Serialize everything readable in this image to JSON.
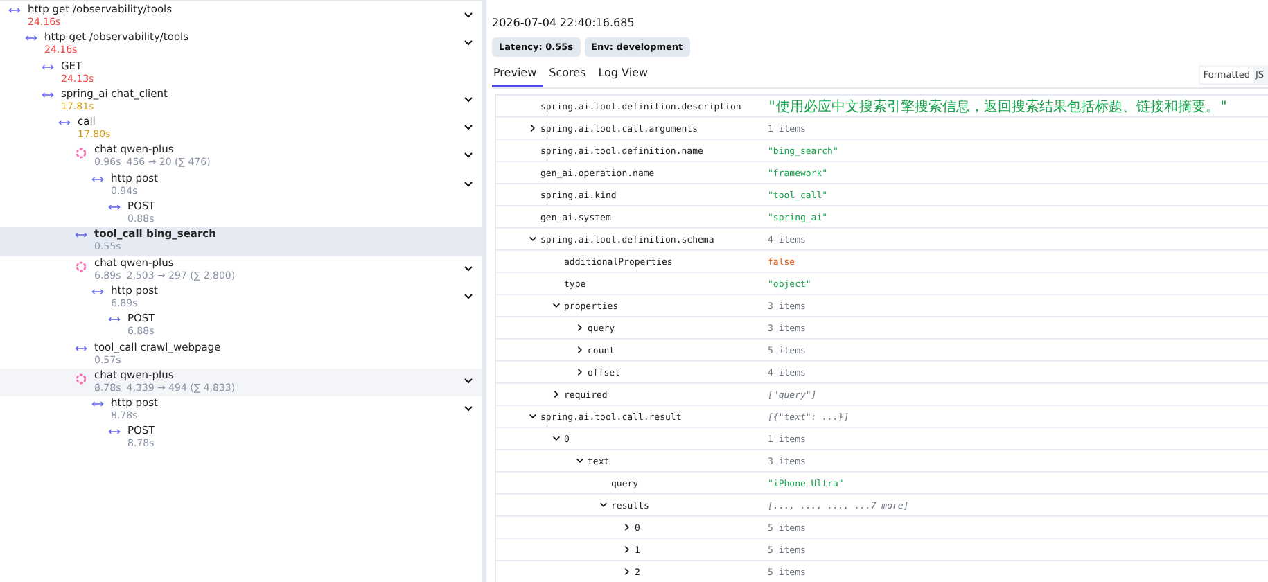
{
  "trace_tree": [
    {
      "name": "http get /observability/tools",
      "kind": "span",
      "duration": "24.16s",
      "color": "#ef4444",
      "expanded": true,
      "selected": false,
      "hovered": false,
      "children": [
        {
          "name": "http get /observability/tools",
          "kind": "span",
          "duration": "24.16s",
          "color": "#ef4444",
          "expanded": true,
          "selected": false,
          "hovered": false,
          "children": [
            {
              "name": "GET",
              "kind": "span",
              "duration": "24.13s",
              "color": "#ef4444",
              "selected": false,
              "hovered": false
            },
            {
              "name": "spring_ai chat_client",
              "kind": "span",
              "duration": "17.81s",
              "color": "#d4a017",
              "expanded": true,
              "selected": false,
              "hovered": false,
              "children": [
                {
                  "name": "call",
                  "kind": "span",
                  "duration": "17.80s",
                  "color": "#d4a017",
                  "expanded": true,
                  "selected": false,
                  "hovered": false,
                  "children": [
                    {
                      "name": "chat qwen-plus",
                      "kind": "generation",
                      "duration": "0.96s",
                      "tokens": "456 → 20 (∑ 476)",
                      "color": "#8a94a6",
                      "expanded": true,
                      "selected": false,
                      "hovered": false,
                      "children": [
                        {
                          "name": "http post",
                          "kind": "span",
                          "duration": "0.94s",
                          "color": "#8a94a6",
                          "expanded": true,
                          "selected": false,
                          "hovered": false,
                          "children": [
                            {
                              "name": "POST",
                              "kind": "span",
                              "duration": "0.88s",
                              "color": "#8a94a6",
                              "selected": false,
                              "hovered": false
                            }
                          ]
                        }
                      ]
                    },
                    {
                      "name": "tool_call bing_search",
                      "kind": "span",
                      "duration": "0.55s",
                      "color": "#8a94a6",
                      "selected": true,
                      "hovered": false
                    },
                    {
                      "name": "chat qwen-plus",
                      "kind": "generation",
                      "duration": "6.89s",
                      "tokens": "2,503 → 297 (∑ 2,800)",
                      "color": "#8a94a6",
                      "expanded": true,
                      "selected": false,
                      "hovered": false,
                      "children": [
                        {
                          "name": "http post",
                          "kind": "span",
                          "duration": "6.89s",
                          "color": "#8a94a6",
                          "expanded": true,
                          "selected": false,
                          "hovered": false,
                          "children": [
                            {
                              "name": "POST",
                              "kind": "span",
                              "duration": "6.88s",
                              "color": "#8a94a6",
                              "selected": false,
                              "hovered": false
                            }
                          ]
                        }
                      ]
                    },
                    {
                      "name": "tool_call crawl_webpage",
                      "kind": "span",
                      "duration": "0.57s",
                      "color": "#8a94a6",
                      "selected": false,
                      "hovered": false
                    },
                    {
                      "name": "chat qwen-plus",
                      "kind": "generation",
                      "duration": "8.78s",
                      "tokens": "4,339 → 494 (∑ 4,833)",
                      "color": "#8a94a6",
                      "expanded": true,
                      "selected": false,
                      "hovered": true,
                      "children": [
                        {
                          "name": "http post",
                          "kind": "span",
                          "duration": "8.78s",
                          "color": "#8a94a6",
                          "expanded": true,
                          "selected": false,
                          "hovered": false,
                          "children": [
                            {
                              "name": "POST",
                              "kind": "span",
                              "duration": "8.78s",
                              "color": "#8a94a6",
                              "selected": false,
                              "hovered": false
                            }
                          ]
                        }
                      ]
                    }
                  ]
                }
              ]
            }
          ]
        }
      ]
    }
  ],
  "detail": {
    "timestamp": "2026-07-04 22:40:16.685",
    "badges": [
      "Latency: 0.55s",
      "Env: development"
    ],
    "tabs": [
      {
        "label": "Preview",
        "selected": true
      },
      {
        "label": "Scores",
        "selected": false
      },
      {
        "label": "Log View",
        "selected": false
      }
    ],
    "view_modes": [
      {
        "label": "Formatted",
        "selected": true
      },
      {
        "label": "JS",
        "selected": false
      }
    ],
    "attributes": [
      {
        "key": "spring.ai.tool.definition.description",
        "value": "\"使用必应中文搜索引擎搜索信息，返回搜索结果包括标题、链接和摘要。\"",
        "kind": "sentence"
      },
      {
        "key": "spring.ai.tool.call.arguments",
        "value": "1 items",
        "kind": "count",
        "expanded": false
      },
      {
        "key": "spring.ai.tool.definition.name",
        "value": "\"bing_search\"",
        "kind": "string"
      },
      {
        "key": "gen_ai.operation.name",
        "value": "\"framework\"",
        "kind": "string"
      },
      {
        "key": "spring.ai.kind",
        "value": "\"tool_call\"",
        "kind": "string"
      },
      {
        "key": "gen_ai.system",
        "value": "\"spring_ai\"",
        "kind": "string"
      },
      {
        "key": "spring.ai.tool.definition.schema",
        "value": "4 items",
        "kind": "count",
        "expanded": true,
        "children": [
          {
            "key": "additionalProperties",
            "value": "false",
            "kind": "boolean"
          },
          {
            "key": "type",
            "value": "\"object\"",
            "kind": "string"
          },
          {
            "key": "properties",
            "value": "3 items",
            "kind": "count",
            "expanded": true,
            "children": [
              {
                "key": "query",
                "value": "3 items",
                "kind": "count",
                "expanded": false
              },
              {
                "key": "count",
                "value": "5 items",
                "kind": "count",
                "expanded": false
              },
              {
                "key": "offset",
                "value": "4 items",
                "kind": "count",
                "expanded": false
              }
            ]
          },
          {
            "key": "required",
            "value": "[\"query\"]",
            "kind": "preview",
            "expanded": false
          }
        ]
      },
      {
        "key": "spring.ai.tool.call.result",
        "value": "[{\"text\": ...}]",
        "kind": "preview",
        "expanded": true,
        "children": [
          {
            "key": "0",
            "value": "1 items",
            "kind": "count",
            "expanded": true,
            "children": [
              {
                "key": "text",
                "value": "3 items",
                "kind": "count",
                "expanded": true,
                "children": [
                  {
                    "key": "query",
                    "value": "\"iPhone Ultra\"",
                    "kind": "string"
                  },
                  {
                    "key": "results",
                    "value": "[..., ..., ..., ...7 more]",
                    "kind": "preview",
                    "expanded": true,
                    "children": [
                      {
                        "key": "0",
                        "value": "5 items",
                        "kind": "count",
                        "expanded": false
                      },
                      {
                        "key": "1",
                        "value": "5 items",
                        "kind": "count",
                        "expanded": false
                      },
                      {
                        "key": "2",
                        "value": "5 items",
                        "kind": "count",
                        "expanded": false
                      }
                    ]
                  }
                ]
              }
            ]
          }
        ]
      }
    ]
  }
}
